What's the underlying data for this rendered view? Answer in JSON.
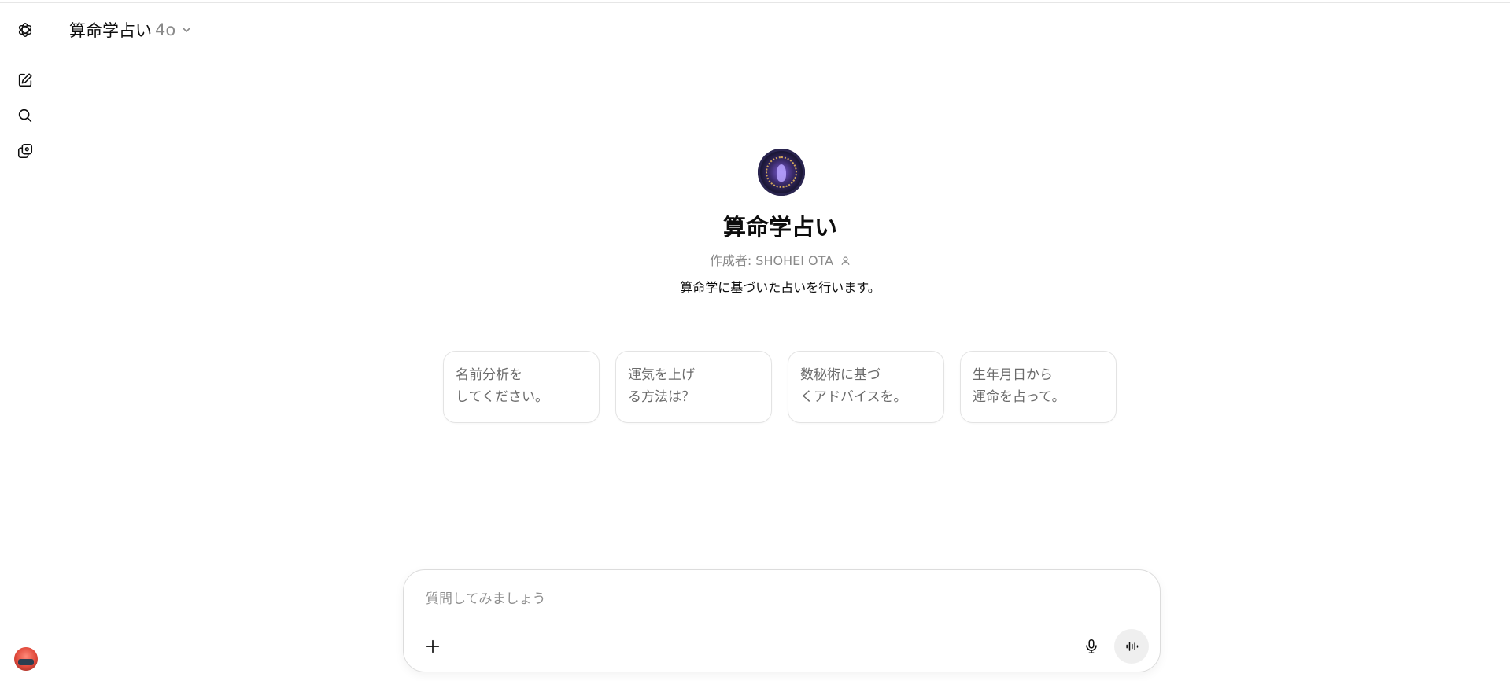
{
  "header": {
    "gpt_name": "算命学占い",
    "model_version": "4o"
  },
  "gpt": {
    "title": "算命学占い",
    "author": "作成者: SHOHEI OTA",
    "description": "算命学に基づいた占いを行います。"
  },
  "starters": [
    {
      "label": "名前分析を\nしてください。"
    },
    {
      "label": "運気を上げ\nる方法は？"
    },
    {
      "label": "数秘術に基づ\nくアドバイスを。"
    },
    {
      "label": "生年月日から\n運命を占って。"
    }
  ],
  "composer": {
    "placeholder": "質問してみましょう"
  },
  "icons": {
    "rail": [
      "openai-logo-icon",
      "new-chat-icon",
      "search-icon",
      "library-icon",
      "user-avatar"
    ],
    "composer": [
      "plus-icon",
      "microphone-icon",
      "voice-mode-icon"
    ]
  }
}
